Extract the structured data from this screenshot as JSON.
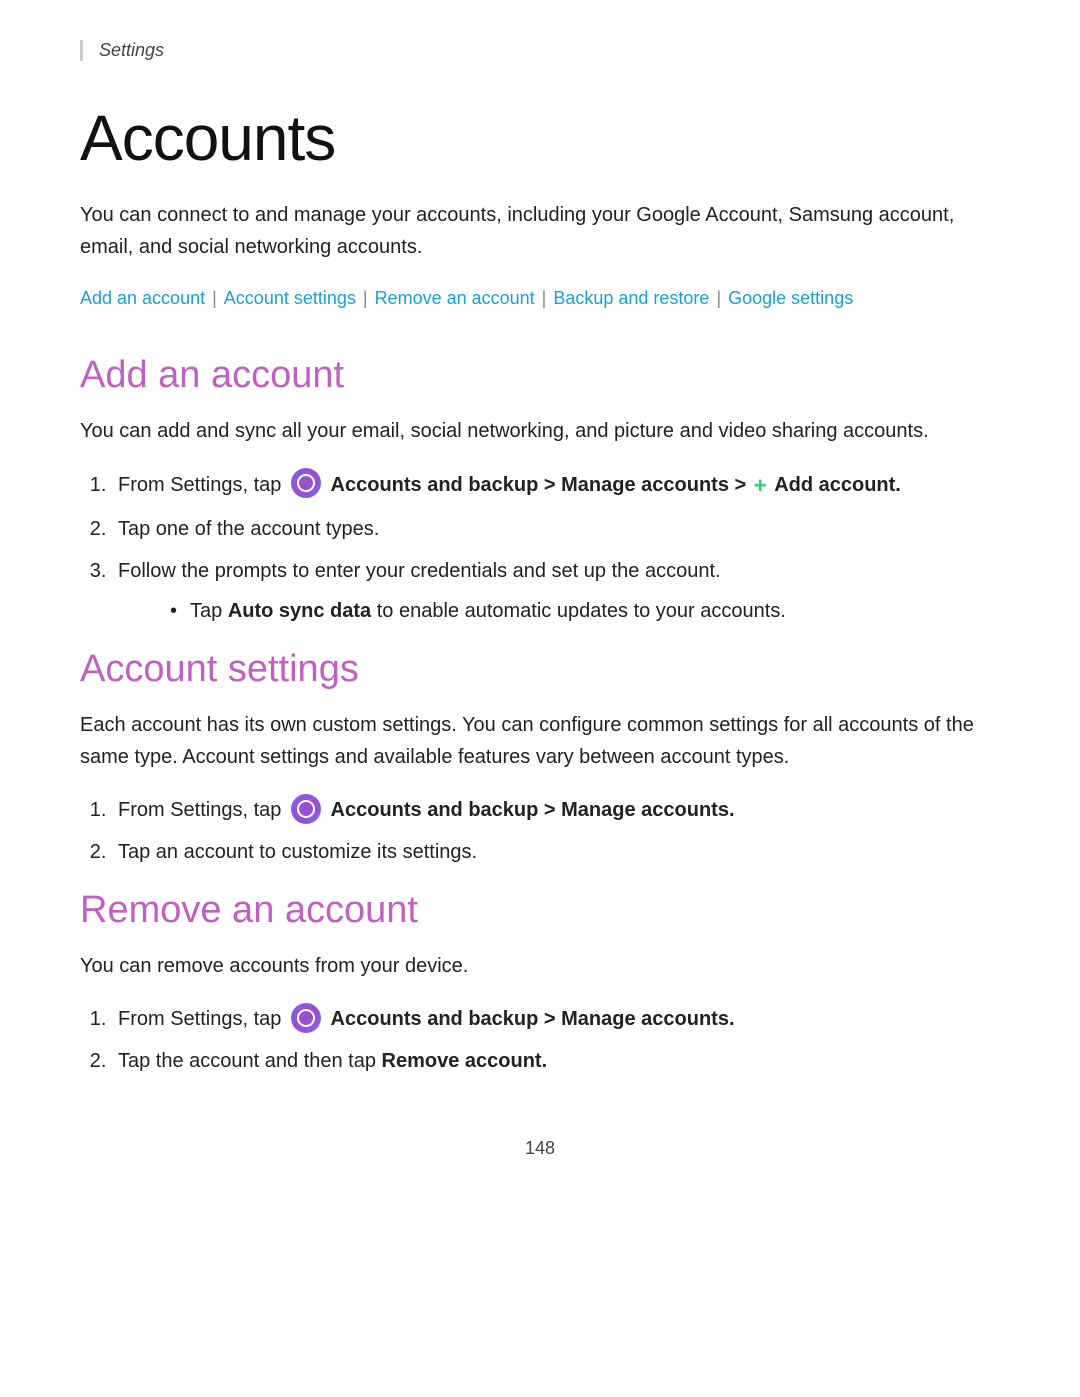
{
  "breadcrumb": {
    "label": "Settings"
  },
  "page": {
    "title": "Accounts",
    "intro": "You can connect to and manage your accounts, including your Google Account, Samsung account, email, and social networking accounts.",
    "page_number": "148"
  },
  "links": {
    "add_account": "Add an account",
    "account_settings": "Account settings",
    "remove_account": "Remove an account",
    "backup_restore": "Backup and restore",
    "google_settings": "Google settings"
  },
  "sections": {
    "add_account": {
      "title": "Add an account",
      "description": "You can add and sync all your email, social networking, and picture and video sharing accounts.",
      "steps": [
        {
          "text_before": "From Settings, tap",
          "icon": "settings-icon",
          "text_bold": "Accounts and backup > Manage accounts >",
          "plus": "+",
          "text_bold2": "Add account."
        },
        {
          "text": "Tap one of the account types."
        },
        {
          "text": "Follow the prompts to enter your credentials and set up the account.",
          "bullet": "Tap Auto sync data to enable automatic updates to your accounts.",
          "bullet_bold": "Auto sync data"
        }
      ]
    },
    "account_settings": {
      "title": "Account settings",
      "description": "Each account has its own custom settings. You can configure common settings for all accounts of the same type. Account settings and available features vary between account types.",
      "steps": [
        {
          "text_before": "From Settings, tap",
          "icon": "settings-icon",
          "text_bold": "Accounts and backup > Manage accounts."
        },
        {
          "text": "Tap an account to customize its settings."
        }
      ]
    },
    "remove_account": {
      "title": "Remove an account",
      "description": "You can remove accounts from your device.",
      "steps": [
        {
          "text_before": "From Settings, tap",
          "icon": "settings-icon",
          "text_bold": "Accounts and backup > Manage accounts."
        },
        {
          "text_before": "Tap the account and then tap",
          "text_bold": "Remove account."
        }
      ]
    }
  }
}
